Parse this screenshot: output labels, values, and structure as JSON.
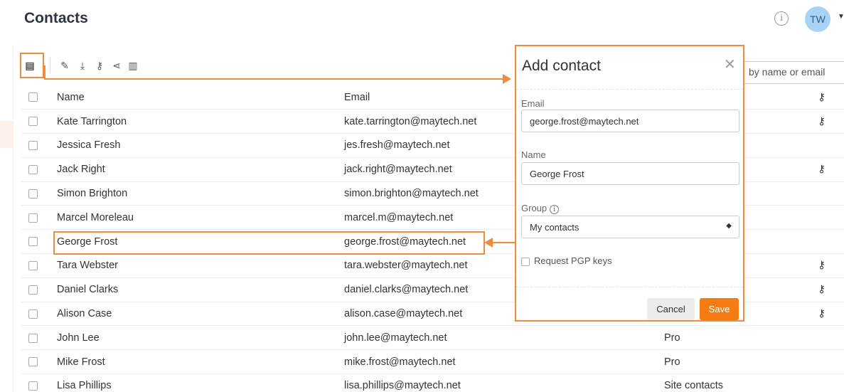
{
  "header": {
    "title": "Contacts",
    "info_icon": "info-icon",
    "avatar_initials": "TW"
  },
  "toolbar": {
    "buttons": [
      {
        "name": "add-contact",
        "icon": "add-contact-icon",
        "glyph": "▦"
      },
      {
        "name": "edit",
        "icon": "pencil-icon",
        "glyph": "✎"
      },
      {
        "name": "download",
        "icon": "download-icon",
        "glyph": "⤓"
      },
      {
        "name": "keys",
        "icon": "key-icon",
        "glyph": "⚷"
      },
      {
        "name": "share",
        "icon": "share-icon",
        "glyph": "⋖"
      },
      {
        "name": "delete",
        "icon": "trash-icon",
        "glyph": "🗑"
      }
    ]
  },
  "search": {
    "placeholder": "by name or email"
  },
  "table": {
    "headers": {
      "name": "Name",
      "email": "Email",
      "group": ""
    },
    "rows": [
      {
        "name": "Kate Tarrington",
        "email": "kate.tarrington@maytech.net",
        "group": "",
        "key": true
      },
      {
        "name": "Jessica Fresh",
        "email": "jes.fresh@maytech.net",
        "group": "",
        "key": false
      },
      {
        "name": "Jack Right",
        "email": "jack.right@maytech.net",
        "group": "",
        "key": true
      },
      {
        "name": "Simon Brighton",
        "email": "simon.brighton@maytech.net",
        "group": "",
        "key": false
      },
      {
        "name": "Marcel Moreleau",
        "email": "marcel.m@maytech.net",
        "group": "",
        "key": false
      },
      {
        "name": "George Frost",
        "email": "george.frost@maytech.net",
        "group": "",
        "key": false
      },
      {
        "name": "Tara Webster",
        "email": "tara.webster@maytech.net",
        "group": "",
        "key": true
      },
      {
        "name": "Daniel Clarks",
        "email": "daniel.clarks@maytech.net",
        "group": "",
        "key": true
      },
      {
        "name": "Alison Case",
        "email": "alison.case@maytech.net",
        "group": "",
        "key": true
      },
      {
        "name": "John Lee",
        "email": "john.lee@maytech.net",
        "group": "Pro",
        "key": false
      },
      {
        "name": "Mike Frost",
        "email": "mike.frost@maytech.net",
        "group": "Pro",
        "key": false
      },
      {
        "name": "Lisa Phillips",
        "email": "lisa.phillips@maytech.net",
        "group": "Site contacts",
        "key": false
      }
    ]
  },
  "modal": {
    "title": "Add contact",
    "email_label": "Email",
    "email_value": "george.frost@maytech.net",
    "name_label": "Name",
    "name_value": "George Frost",
    "group_label": "Group",
    "group_value": "My contacts",
    "pgp_label": "Request PGP keys",
    "cancel_label": "Cancel",
    "save_label": "Save"
  },
  "colors": {
    "accent": "#f08a3c",
    "save": "#f57c12",
    "avatar": "#a9d3f5"
  }
}
